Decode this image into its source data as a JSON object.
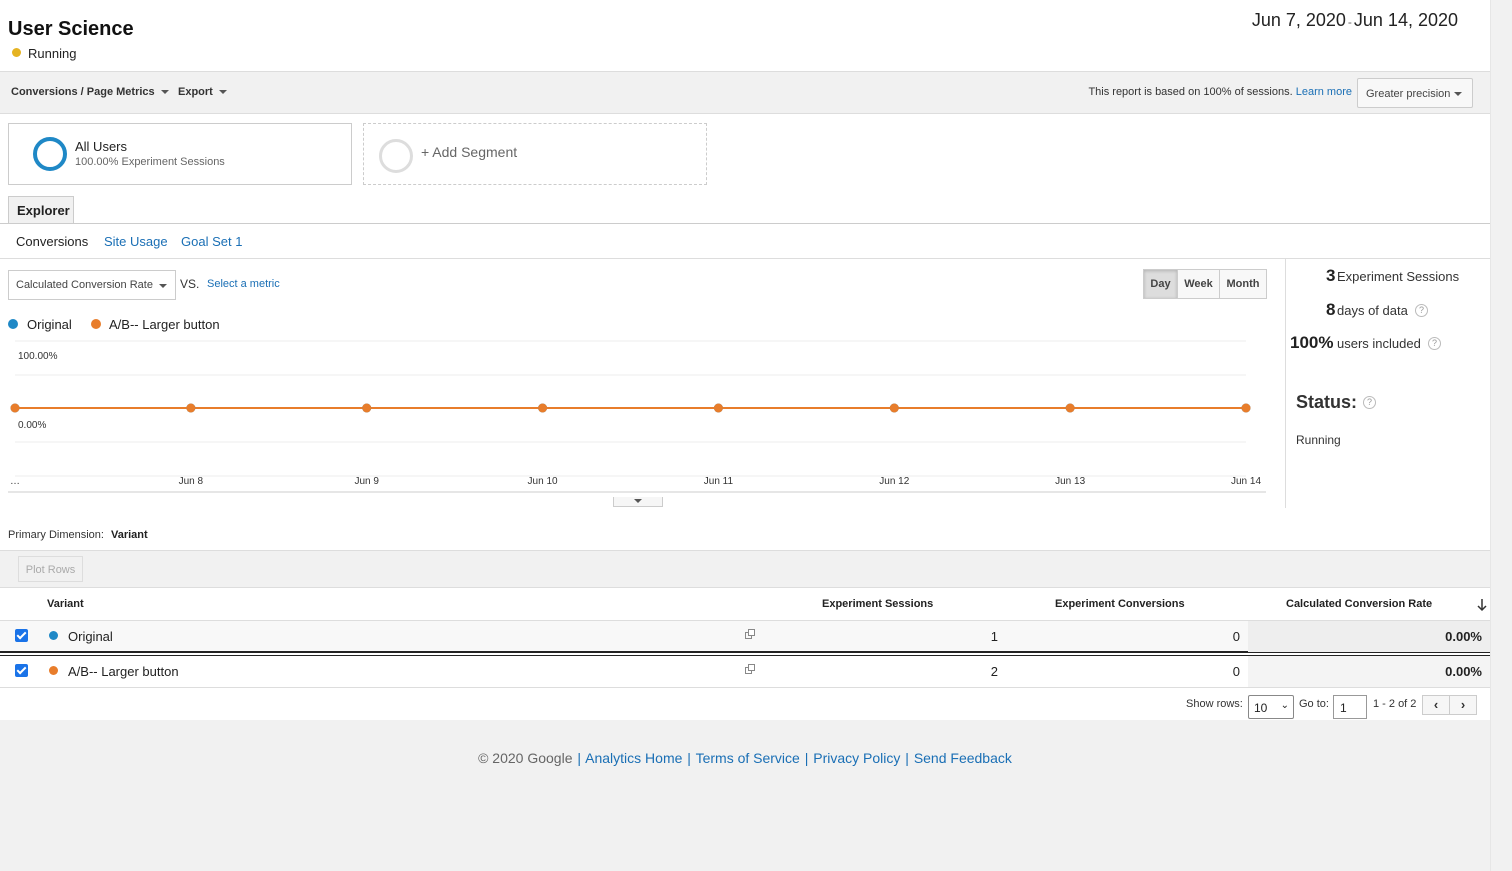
{
  "header": {
    "title": "User Science",
    "status": "Running",
    "date_start": "Jun 7, 2020",
    "date_sep": "-",
    "date_end": "Jun 14, 2020"
  },
  "toolbar": {
    "breadcrumb": "Conversions / Page Metrics",
    "export": "Export",
    "sampling_note": "This report is based on 100% of sessions.",
    "learn_more": "Learn more",
    "precision": "Greater precision"
  },
  "segments": [
    {
      "name": "All Users",
      "sub": "100.00% Experiment Sessions"
    },
    {
      "name": "+ Add Segment"
    }
  ],
  "explorer_tab": "Explorer",
  "subtabs": [
    "Conversions",
    "Site Usage",
    "Goal Set 1"
  ],
  "metric": {
    "selected": "Calculated Conversion Rate",
    "vs": "VS.",
    "select_metric": "Select a metric"
  },
  "periods": [
    "Day",
    "Week",
    "Month"
  ],
  "legend": [
    {
      "name": "Original",
      "color": "#1f88c6"
    },
    {
      "name": "A/B-- Larger button",
      "color": "#e87d2b"
    }
  ],
  "chart_data": {
    "type": "line",
    "x": [
      "…",
      "Jun 8",
      "Jun 9",
      "Jun 10",
      "Jun 11",
      "Jun 12",
      "Jun 13",
      "Jun 14"
    ],
    "y_tick_labels": [
      "100.00%",
      "0.00%"
    ],
    "ylim": [
      0,
      1
    ],
    "series": [
      {
        "name": "Original",
        "values": [
          0,
          0,
          0,
          0,
          0,
          0,
          0,
          0
        ],
        "color": "#1f88c6"
      },
      {
        "name": "A/B-- Larger button",
        "values": [
          0,
          0,
          0,
          0,
          0,
          0,
          0,
          0
        ],
        "color": "#e87d2b"
      }
    ]
  },
  "stats": {
    "sessions_num": "3",
    "sessions_label": "Experiment Sessions",
    "days_num": "8",
    "days_label": "days of data",
    "users_num": "100%",
    "users_label": "users included",
    "status_head": "Status:",
    "status_val": "Running"
  },
  "table": {
    "primary_dimension_label": "Primary Dimension:",
    "primary_dimension_value": "Variant",
    "plot_rows": "Plot Rows",
    "headers": [
      "Variant",
      "Experiment Sessions",
      "Experiment Conversions",
      "Calculated Conversion Rate"
    ],
    "rows": [
      {
        "variant": "Original",
        "color": "#1f88c6",
        "sessions": "1",
        "conversions": "0",
        "rate": "0.00%"
      },
      {
        "variant": "A/B-- Larger button",
        "color": "#e87d2b",
        "sessions": "2",
        "conversions": "0",
        "rate": "0.00%"
      }
    ]
  },
  "pager": {
    "show_rows": "Show rows:",
    "rows_value": "10",
    "goto": "Go to:",
    "goto_value": "1",
    "range": "1 - 2 of 2"
  },
  "footer": {
    "copyright": "© 2020 Google",
    "links": [
      "Analytics Home",
      "Terms of Service",
      "Privacy Policy",
      "Send Feedback"
    ]
  }
}
